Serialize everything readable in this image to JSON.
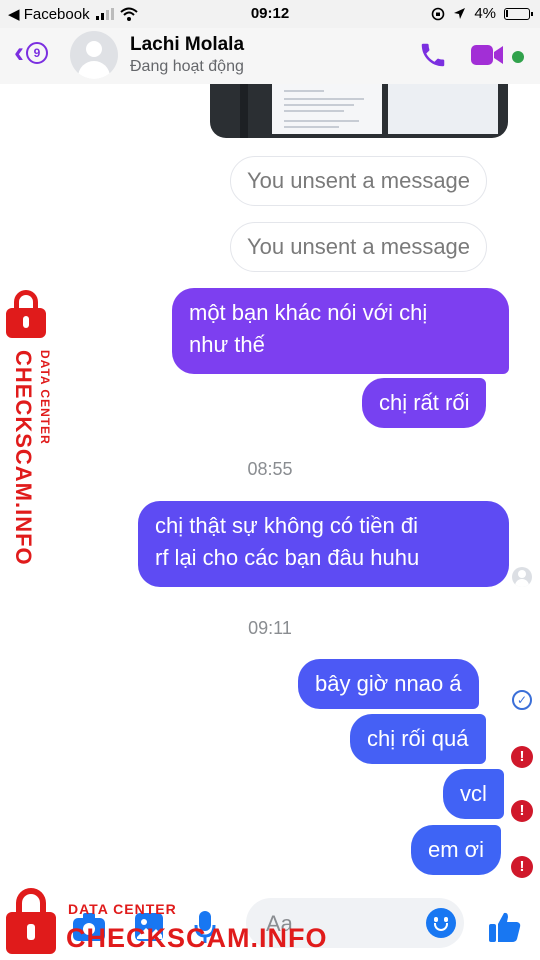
{
  "status_bar": {
    "carrier": "◀ Facebook",
    "time": "09:12",
    "battery_percent": "4%"
  },
  "header": {
    "back_badge": "9",
    "contact_name": "Lachi Molala",
    "contact_status": "Đang hoạt động",
    "icons": [
      "back-icon",
      "phone-icon",
      "video-camera-icon"
    ],
    "accent_color": "#7b2fe0",
    "online_color": "#31a24c"
  },
  "messages": {
    "unsent_1": "You unsent a message",
    "unsent_2": "You unsent a message",
    "m1": "một bạn khác nói với chị",
    "m1b": "như thế",
    "m2": "chị rất rối",
    "time_1": "08:55",
    "m3": "chị thật sự không có tiền đi",
    "m3b": "rf lại cho các bạn đâu huhu",
    "time_2": "09:11",
    "m4": "bây giờ nnao á",
    "m5": "chị rối quá",
    "m6": "vcl",
    "m7": "em ơi",
    "error_mark": "!",
    "sent_mark": "✓",
    "bubble_colors": [
      "#7d3ff0",
      "#6a45f2",
      "#5a4ef4",
      "#4a5cf5",
      "#3e62f5"
    ],
    "error_color": "#d0182b"
  },
  "composer": {
    "placeholder": "Aa",
    "icons": [
      "camera-icon",
      "gallery-icon",
      "microphone-icon",
      "emoji-icon",
      "thumbs-up-icon"
    ]
  },
  "watermark": {
    "side_big": "CHECKSCAM.INFO",
    "side_small": "DATA CENTER",
    "bottom_small": "DATA CENTER",
    "bottom_big": "CHECKSCAM.INFO",
    "color": "#e01b1b"
  }
}
